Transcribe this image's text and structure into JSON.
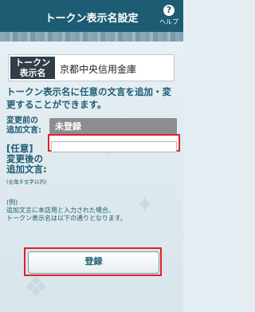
{
  "header": {
    "title": "トークン表示名設定",
    "help_label": "ヘルプ"
  },
  "token": {
    "badge_line1": "トークン",
    "badge_line2": "表示名",
    "name": "京都中央信用金庫"
  },
  "description": "トークン表示名に任意の文言を追加・変更することができます。",
  "before": {
    "label_line1": "変更前の",
    "label_line2": "追加文言:",
    "value": "未登録"
  },
  "after": {
    "label_line1": "[任意]",
    "label_line2": "変更後の",
    "label_line3": "追加文言:",
    "note": "(全角８文字以内)",
    "value": "",
    "placeholder": ""
  },
  "example": {
    "heading": "(例)",
    "line1": "追加文言に本店用と入力された場合、",
    "line2": "トークン表示名は以下の通りとなります。"
  },
  "register_button": "登録",
  "colors": {
    "header": "#1d5c73",
    "accent": "#e0202c",
    "badge": "#2f3e48"
  }
}
